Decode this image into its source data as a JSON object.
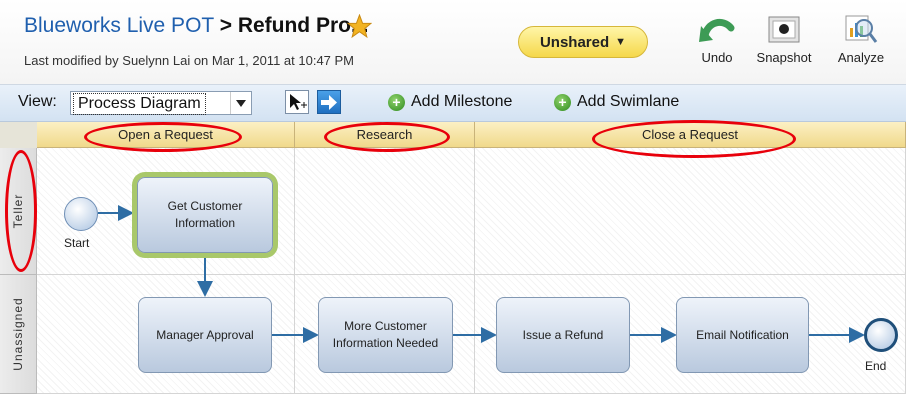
{
  "header": {
    "app_link": "Blueworks Live POT",
    "separator": ">",
    "process_name": "Refund Pro...",
    "last_modified": "Last modified by Suelynn Lai on Mar 1, 2011 at 10:47 PM",
    "share_label": "Unshared",
    "tools": [
      {
        "label": "Undo",
        "icon": "undo-icon"
      },
      {
        "label": "Snapshot",
        "icon": "camera-icon"
      },
      {
        "label": "Analyze",
        "icon": "analyze-icon"
      }
    ]
  },
  "toolbar": {
    "view_label": "View:",
    "view_value": "Process Diagram",
    "add_milestone": "Add Milestone",
    "add_swimlane": "Add Swimlane"
  },
  "diagram": {
    "milestones": [
      "Open a Request",
      "Research",
      "Close a Request"
    ],
    "lanes": [
      "Teller",
      "Unassigned"
    ],
    "start_label": "Start",
    "end_label": "End",
    "tasks": {
      "get_customer_info": "Get Customer Information",
      "manager_approval": "Manager Approval",
      "more_customer_info": "More Customer Information Needed",
      "issue_refund": "Issue a Refund",
      "email_notification": "Email Notification"
    }
  },
  "colors": {
    "link": "#1f5fae",
    "annotation": "#e8000b",
    "selection": "#a9c86a",
    "connector": "#2e6da4"
  }
}
